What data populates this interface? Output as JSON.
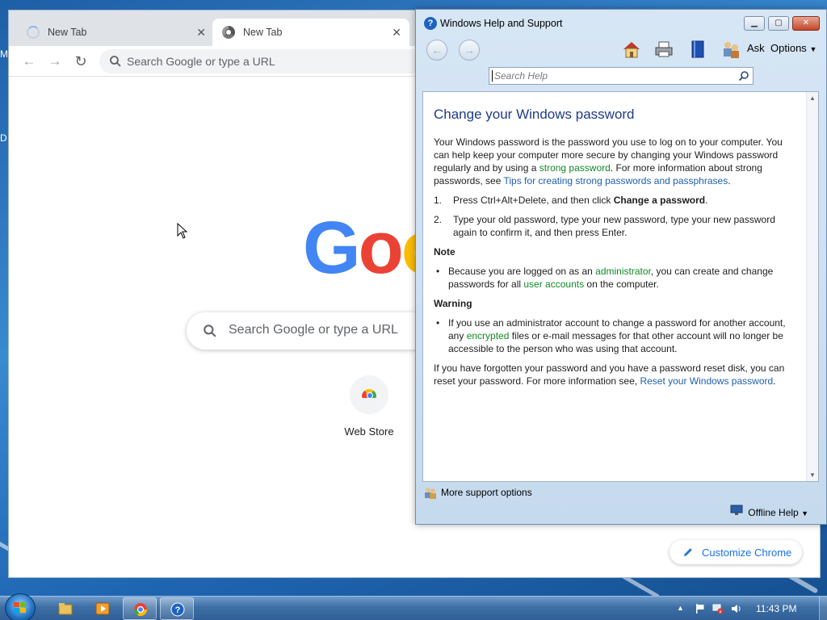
{
  "desktop": {
    "edge_letters": [
      "M",
      "D"
    ]
  },
  "chrome": {
    "tabs": [
      {
        "label": "New Tab",
        "state": "loading"
      },
      {
        "label": "New Tab",
        "state": "active"
      }
    ],
    "omnibox_placeholder": "Search Google or type a URL",
    "logo_text": "Goo",
    "ntp_search_placeholder": "Search Google or type a URL",
    "shortcut_label": "Web Store",
    "customize_label": "Customize Chrome"
  },
  "help": {
    "title": "Windows Help and Support",
    "toolbar": {
      "ask_label": "Ask",
      "options_label": "Options"
    },
    "search_placeholder": "Search Help",
    "article": {
      "title": "Change your Windows password",
      "intro_1": "Your Windows password is the password you use to log on to your computer. You can help keep your computer more secure by changing your Windows password regularly and by using a ",
      "intro_link_1": "strong password",
      "intro_2": ". For more information about strong passwords, see ",
      "intro_link_2": "Tips for creating strong passwords and passphrases",
      "intro_3": ".",
      "step1_num": "1.",
      "step1_text": "Press Ctrl+Alt+Delete, and then click ",
      "step1_bold": "Change a password",
      "step1_end": ".",
      "step2_num": "2.",
      "step2_text": "Type your old password, type your new password, type your new password again to confirm it, and then press Enter.",
      "note_heading": "Note",
      "note_1": "Because you are logged on as an ",
      "note_link_1": "administrator",
      "note_2": ", you can create and change passwords for all ",
      "note_link_2": "user accounts",
      "note_3": " on the computer.",
      "warning_heading": "Warning",
      "warning_1": "If you use an administrator account to change a password for another account, any ",
      "warning_link": "encrypted",
      "warning_2": " files or e-mail messages for that other account will no longer be accessible to the person who was using that account.",
      "outro_1": "If you have forgotten your password and you have a password reset disk, you can reset your password. For more information see, ",
      "outro_link": "Reset your Windows password",
      "outro_2": "."
    },
    "more_support_label": "More support options",
    "offline_help_label": "Offline Help"
  },
  "taskbar": {
    "apps": [
      "windows-explorer",
      "media-player",
      "google-chrome",
      "help-and-support"
    ],
    "clock": "11:43 PM"
  },
  "colors": {
    "link_green": "#128a28",
    "link_blue": "#1f5fb0",
    "title_blue": "#1f3b8a",
    "chrome_accent": "#1a73e8"
  }
}
